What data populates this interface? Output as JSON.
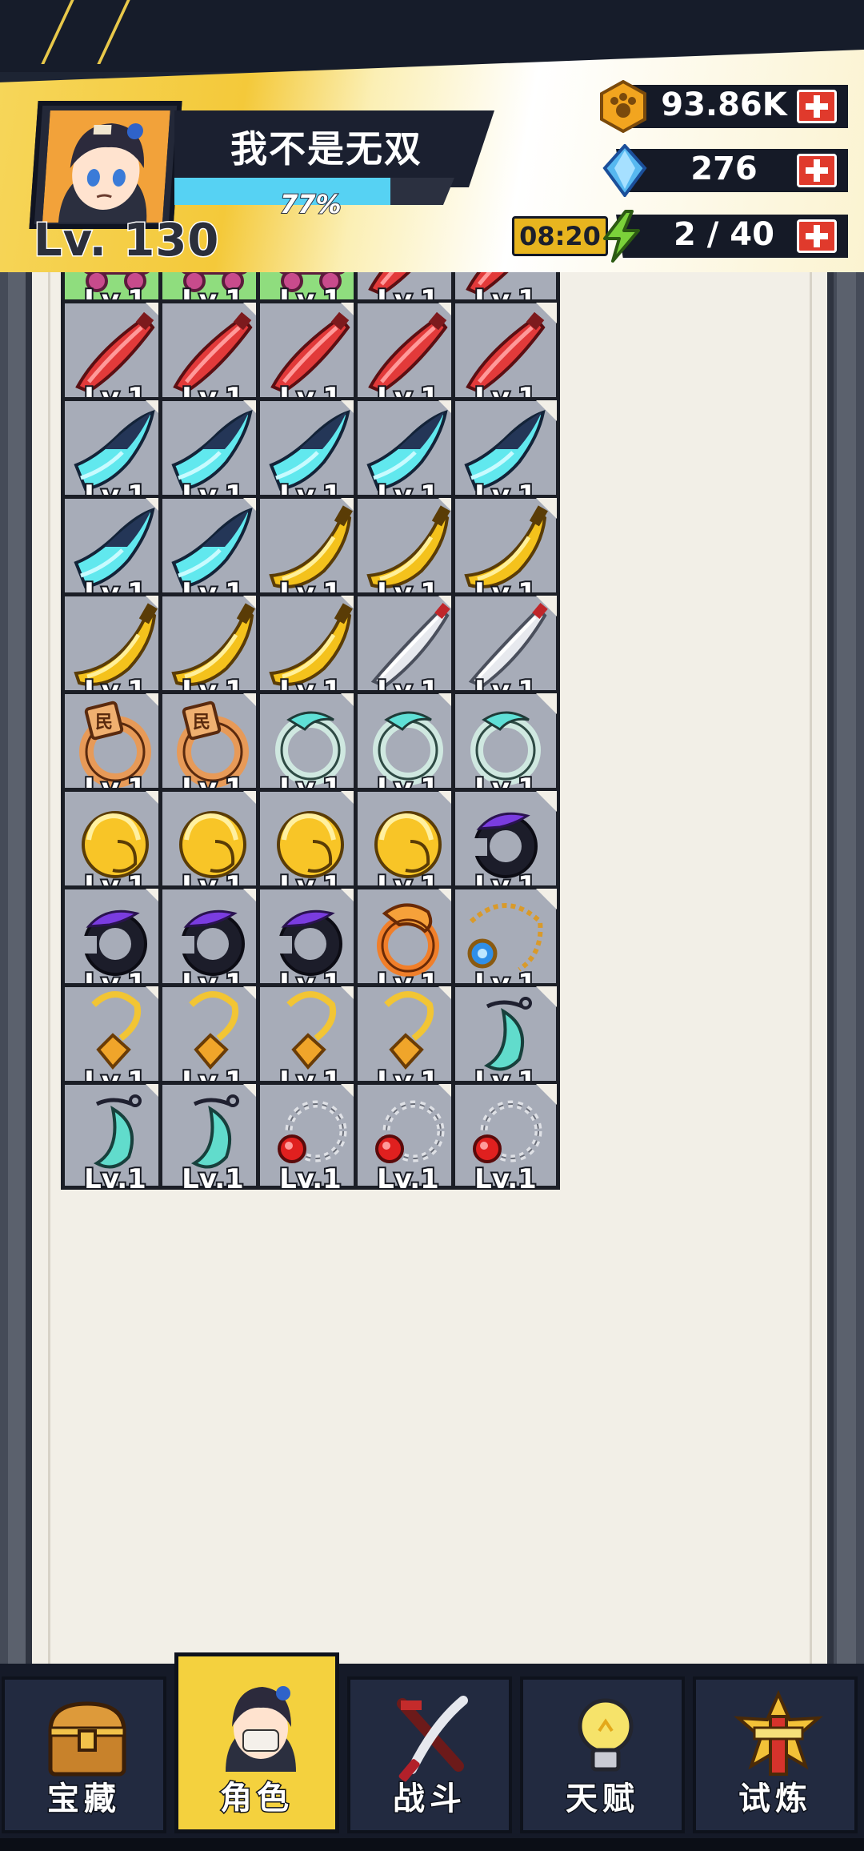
{
  "player": {
    "name": "我不是无双",
    "level_text": "Lv. 130",
    "xp_percent_text": "77%",
    "xp_fraction": 0.77
  },
  "resources": {
    "gold": {
      "icon": "paw-coin-icon",
      "value": "93.86K"
    },
    "gems": {
      "icon": "blue-crystal-icon",
      "value": "276"
    },
    "energy": {
      "icon": "lightning-icon",
      "value": "2 / 40",
      "timer": "08:20"
    }
  },
  "inventory": {
    "level_label": "Lv.1",
    "rows": [
      [
        "roller-skate",
        "roller-skate",
        "roller-skate",
        "red-sword",
        "red-sword"
      ],
      [
        "red-sword",
        "red-sword",
        "red-sword",
        "red-sword",
        "red-sword"
      ],
      [
        "cyan-blade",
        "cyan-blade",
        "cyan-blade",
        "cyan-blade",
        "cyan-blade"
      ],
      [
        "cyan-blade",
        "cyan-blade",
        "yellow-blade",
        "yellow-blade",
        "yellow-blade"
      ],
      [
        "yellow-blade",
        "yellow-blade",
        "yellow-blade",
        "white-blade",
        "white-blade"
      ],
      [
        "copper-ring",
        "copper-ring",
        "jade-ring",
        "jade-ring",
        "jade-ring"
      ],
      [
        "gold-ring",
        "gold-ring",
        "gold-ring",
        "gold-ring",
        "purple-ring"
      ],
      [
        "purple-ring",
        "purple-ring",
        "purple-ring",
        "dragon-ring",
        "sapphire-necklace"
      ],
      [
        "gold-pendant",
        "gold-pendant",
        "gold-pendant",
        "gold-pendant",
        "teal-pendant"
      ],
      [
        "teal-pendant",
        "teal-pendant",
        "ruby-bracelet",
        "ruby-bracelet",
        "ruby-bracelet"
      ]
    ]
  },
  "nav": {
    "tabs": [
      {
        "label": "宝藏",
        "icon": "treasure-chest-icon",
        "active": false
      },
      {
        "label": "角色",
        "icon": "character-avatar-icon",
        "active": true
      },
      {
        "label": "战斗",
        "icon": "crossed-swords-icon",
        "active": false
      },
      {
        "label": "天赋",
        "icon": "lightbulb-icon",
        "active": false
      },
      {
        "label": "试炼",
        "icon": "trial-emblem-icon",
        "active": false
      }
    ]
  },
  "colors": {
    "header_yellow": "#f4c93a",
    "slot_gray": "#a7acb8",
    "slot_green": "#8fdd7e",
    "panel_bg": "#f2efe7",
    "xp_blue": "#56d2f3",
    "plus_red": "#e03a2c",
    "nav_active": "#f4d13e"
  }
}
